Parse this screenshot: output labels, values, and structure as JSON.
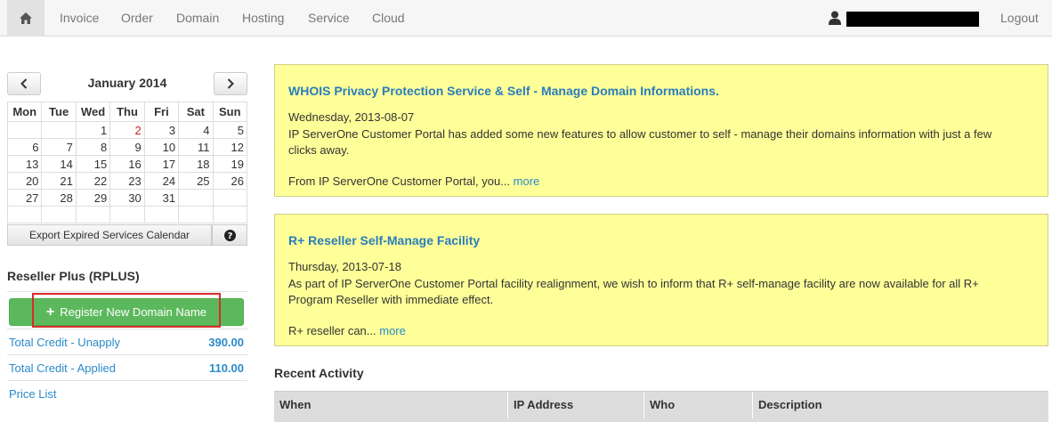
{
  "nav": {
    "home_icon": "home-icon",
    "items": [
      "Invoice",
      "Order",
      "Domain",
      "Hosting",
      "Service",
      "Cloud"
    ],
    "user_icon": "user-icon",
    "logout": "Logout"
  },
  "calendar": {
    "title": "January 2014",
    "prev_icon": "chevron-left-icon",
    "next_icon": "chevron-right-icon",
    "weekdays": [
      "Mon",
      "Tue",
      "Wed",
      "Thu",
      "Fri",
      "Sat",
      "Sun"
    ],
    "weeks": [
      [
        "",
        "",
        "1",
        "2",
        "3",
        "4",
        "5"
      ],
      [
        "6",
        "7",
        "8",
        "9",
        "10",
        "11",
        "12"
      ],
      [
        "13",
        "14",
        "15",
        "16",
        "17",
        "18",
        "19"
      ],
      [
        "20",
        "21",
        "22",
        "23",
        "24",
        "25",
        "26"
      ],
      [
        "27",
        "28",
        "29",
        "30",
        "31",
        "",
        ""
      ],
      [
        "",
        "",
        "",
        "",
        "",
        "",
        ""
      ]
    ],
    "highlighted_day": "2",
    "export_label": "Export Expired Services Calendar",
    "help_icon": "question-circle-icon"
  },
  "reseller": {
    "title": "Reseller Plus (RPLUS)",
    "register_label": "Register New Domain Name",
    "register_icon": "plus-icon",
    "credits": [
      {
        "label": "Total Credit - Unapply",
        "value": "390.00"
      },
      {
        "label": "Total Credit - Applied",
        "value": "110.00"
      }
    ],
    "price_list": "Price List"
  },
  "announcements": [
    {
      "title": "WHOIS Privacy Protection Service & Self - Manage Domain Informations.",
      "date": "Wednesday, 2013-08-07",
      "body": "IP ServerOne Customer Portal has added some new features to allow customer to self - manage their domains information with just a few clicks away.",
      "excerpt": "From IP ServerOne Customer Portal, you...",
      "more": "more"
    },
    {
      "title": "R+ Reseller Self-Manage Facility",
      "date": "Thursday, 2013-07-18",
      "body": "As part of IP ServerOne Customer Portal facility realignment, we wish to inform that R+ self-manage facility are now available for all R+ Program Reseller with immediate effect.",
      "excerpt": "R+ reseller can...",
      "more": "more"
    }
  ],
  "activity": {
    "title": "Recent Activity",
    "columns": [
      "When",
      "IP Address",
      "Who",
      "Description"
    ]
  },
  "colors": {
    "accent_link": "#2a8ac9",
    "announcement_bg": "#ffff99",
    "register_green": "#5cb85c",
    "highlight_red": "#d92b2b"
  }
}
